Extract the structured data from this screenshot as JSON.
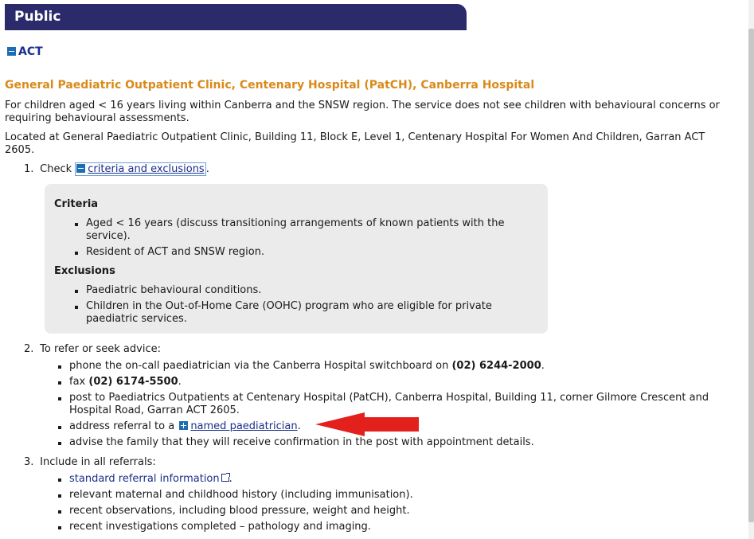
{
  "header": {
    "title": "Public"
  },
  "region": {
    "label": "ACT"
  },
  "clinic": {
    "title": "General Paediatric Outpatient Clinic, Centenary Hospital (PatCH), Canberra Hospital",
    "description_1": "For children aged < 16 years living within Canberra and the SNSW region. The service does not see children with behavioural concerns or",
    "description_2": "requiring behavioural assessments.",
    "location_1": "Located at General Paediatric Outpatient Clinic, Building 11, Block E, Level 1, Centenary Hospital For Women And Children, Garran ACT",
    "location_2": "2605."
  },
  "step1": {
    "num": "1.",
    "prefix": "Check",
    "link": "criteria and exclusions",
    "suffix": "."
  },
  "criteria": {
    "heading": "Criteria",
    "items": [
      {
        "line1": "Aged < 16 years (discuss transitioning arrangements of known patients with the",
        "line2": "service)."
      },
      {
        "line1": "Resident of ACT and SNSW region.",
        "line2": ""
      }
    ]
  },
  "exclusions": {
    "heading": "Exclusions",
    "items": [
      {
        "line1": "Paediatric behavioural conditions.",
        "line2": ""
      },
      {
        "line1": "Children in the Out-of-Home Care (OOHC) program who are eligible for private",
        "line2": "paediatric services."
      }
    ]
  },
  "step2": {
    "num": "2.",
    "text": "To refer or seek advice:",
    "phone_prefix": "phone the on-call paediatrician via the Canberra Hospital switchboard on",
    "phone_number": "(02) 6244-2000",
    "phone_suffix": ".",
    "fax_prefix": "fax",
    "fax_number": "(02) 6174-5500",
    "fax_suffix": ".",
    "post_line1": "post to Paediatrics Outpatients at Centenary Hospital (PatCH), Canberra Hospital, Building 11, corner Gilmore Crescent and",
    "post_line2": "Hospital Road, Garran ACT 2605.",
    "address_prefix": "address referral to a",
    "address_link": "named paediatrician",
    "address_suffix": ".",
    "advise": "advise the family that they will receive confirmation in the post with appointment details."
  },
  "step3": {
    "num": "3.",
    "text": "Include in all referrals:",
    "standard_link": "standard referral information",
    "standard_suffix": ".",
    "items": [
      "relevant maternal and childhood history (including immunisation).",
      "recent observations, including blood pressure, weight and height.",
      "recent investigations completed – pathology and imaging."
    ]
  },
  "colors": {
    "header_bg": "#2b2a6b",
    "title_orange": "#d98a1a",
    "link_blue": "#1a2f8a",
    "arrow_red": "#e3211c",
    "criteria_bg": "#ebebeb"
  }
}
